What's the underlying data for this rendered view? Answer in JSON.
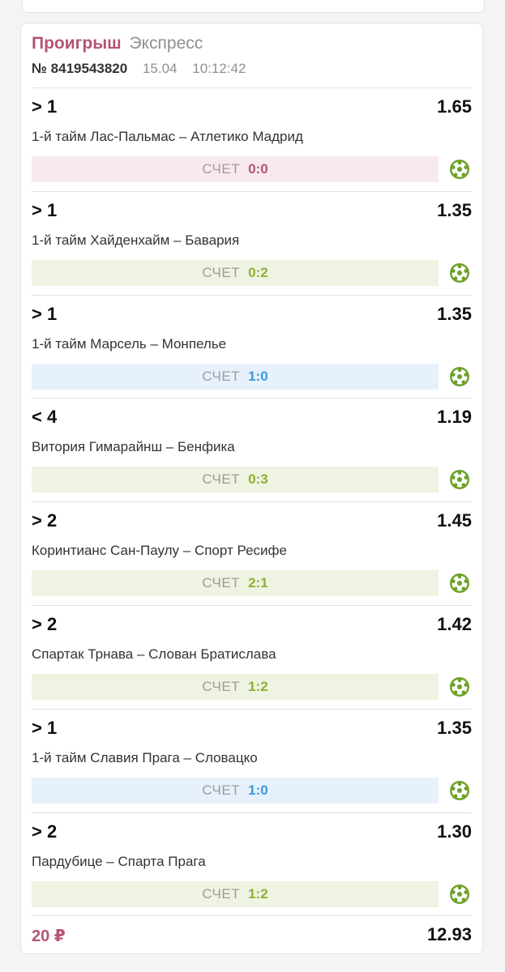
{
  "bet_slip": {
    "status": "Проигрыш",
    "type": "Экспресс",
    "number": "№ 8419543820",
    "date": "15.04",
    "time": "10:12:42",
    "score_label": "СЧЕТ",
    "stake": "20 ₽",
    "total_odds": "12.93"
  },
  "events": [
    {
      "bet": "> 1",
      "odds": "1.65",
      "match": "1-й тайм Лас-Пальмас – Атлетико Мадрид",
      "score": "0:0",
      "result": "lost"
    },
    {
      "bet": "> 1",
      "odds": "1.35",
      "match": "1-й тайм Хайденхайм – Бавария",
      "score": "0:2",
      "result": "win"
    },
    {
      "bet": "> 1",
      "odds": "1.35",
      "match": "1-й тайм Марсель – Монпелье",
      "score": "1:0",
      "result": "neutral"
    },
    {
      "bet": "< 4",
      "odds": "1.19",
      "match": "Витория Гимарайнш – Бенфика",
      "score": "0:3",
      "result": "win"
    },
    {
      "bet": "> 2",
      "odds": "1.45",
      "match": "Коринтианс Сан-Паулу – Спорт Ресифе",
      "score": "2:1",
      "result": "win"
    },
    {
      "bet": "> 2",
      "odds": "1.42",
      "match": "Спартак Трнава – Слован Братислава",
      "score": "1:2",
      "result": "win"
    },
    {
      "bet": "> 1",
      "odds": "1.35",
      "match": "1-й тайм Славия Прага – Словацко",
      "score": "1:0",
      "result": "neutral"
    },
    {
      "bet": "> 2",
      "odds": "1.30",
      "match": "Пардубице – Спарта Прага",
      "score": "1:2",
      "result": "win"
    }
  ],
  "colors": {
    "lost": "#b45478",
    "win": "#8db22e",
    "neutral": "#3a9ae0",
    "soccer_icon": "#6fa12a"
  },
  "icons": {
    "sport": "soccer-ball-icon"
  }
}
